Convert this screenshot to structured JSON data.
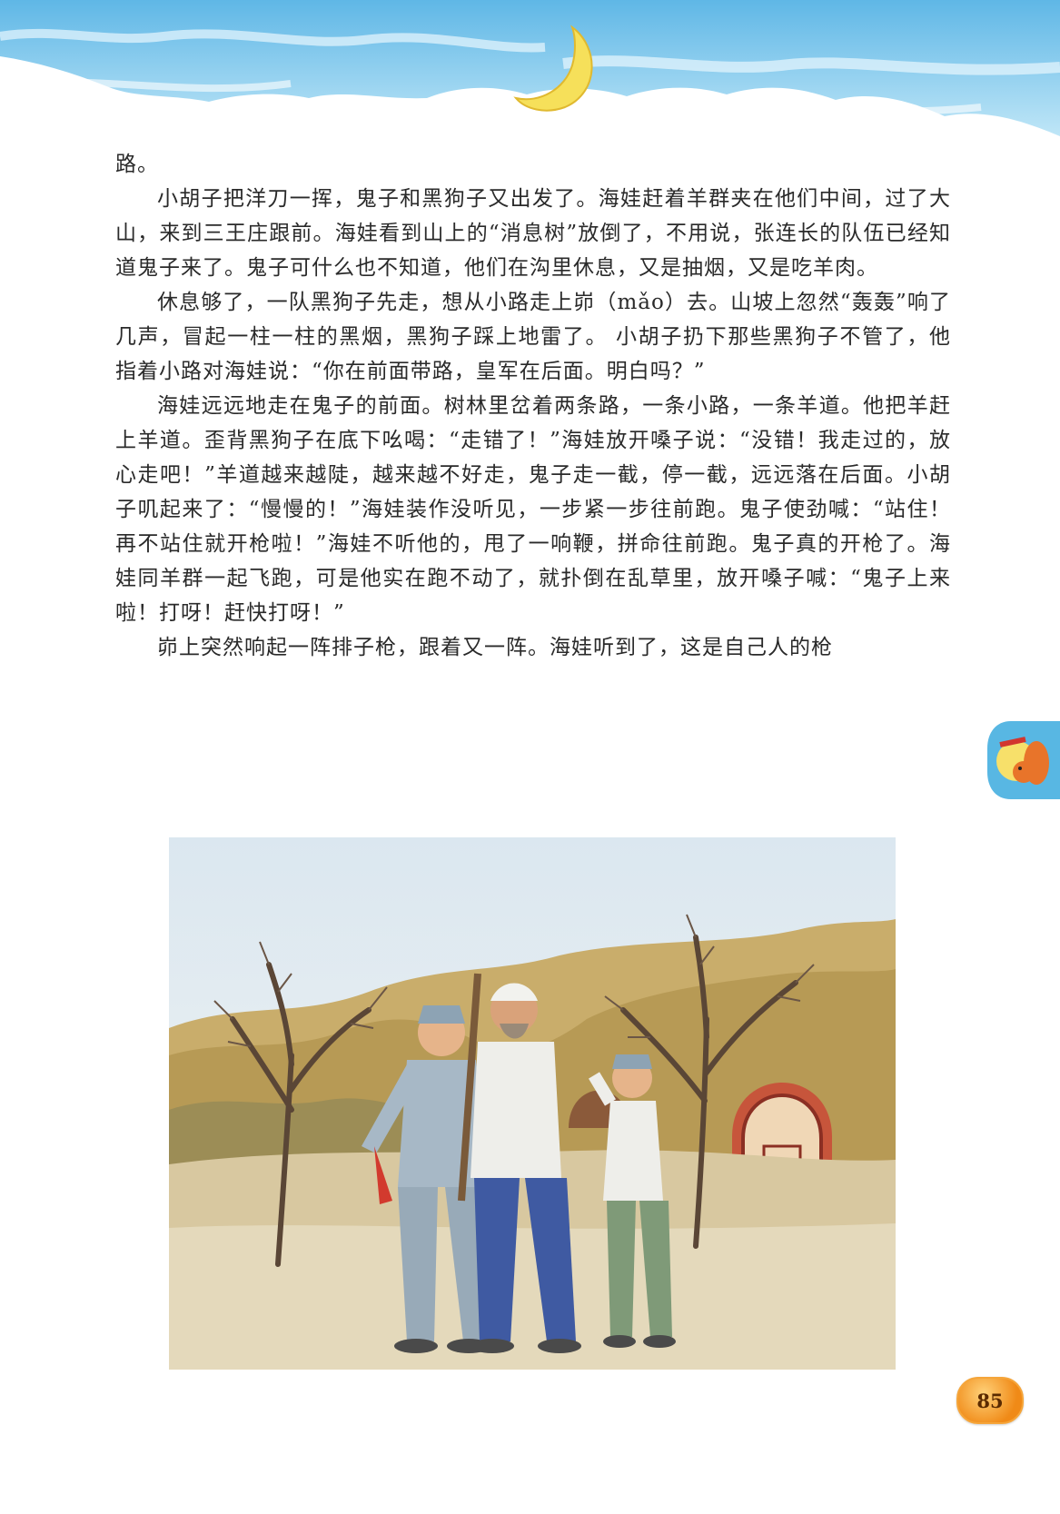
{
  "paragraphs": [
    "路。",
    "小胡子把洋刀一挥，鬼子和黑狗子又出发了。海娃赶着羊群夹在他们中间，过了大山，来到三王庄跟前。海娃看到山上的“消息树”放倒了，不用说，张连长的队伍已经知道鬼子来了。鬼子可什么也不知道，他们在沟里休息，又是抽烟，又是吃羊肉。",
    "休息够了，一队黑狗子先走，想从小路走上峁（mǎo）去。山坡上忽然“轰轰”响了几声，冒起一柱一柱的黑烟，黑狗子踩上地雷了。 小胡子扔下那些黑狗子不管了，他指着小路对海娃说：“你在前面带路，皇军在后面。明白吗？”",
    "海娃远远地走在鬼子的前面。树林里岔着两条路，一条小路，一条羊道。他把羊赶上羊道。歪背黑狗子在底下吆喝：“走错了！”海娃放开嗓子说：“没错！我走过的，放心走吧！”羊道越来越陡，越来越不好走，鬼子走一截，停一截，远远落在后面。小胡子叽起来了：“慢慢的！”海娃装作没听见，一步紧一步往前跑。鬼子使劲喊：“站住！再不站住就开枪啦！”海娃不听他的，甩了一响鞭，拼命往前跑。鬼子真的开枪了。海娃同羊群一起飞跑，可是他实在跑不动了，就扑倒在乱草里，放开嗓子喊：“鬼子上来啦！打呀！赶快打呀！”",
    "峁上突然响起一阵排子枪，跟着又一阵。海娃听到了，这是自己人的枪"
  ],
  "page_number": "85",
  "colors": {
    "sky": "#7ec8ea",
    "moon": "#f6e05a",
    "badge": "#f08a17"
  }
}
